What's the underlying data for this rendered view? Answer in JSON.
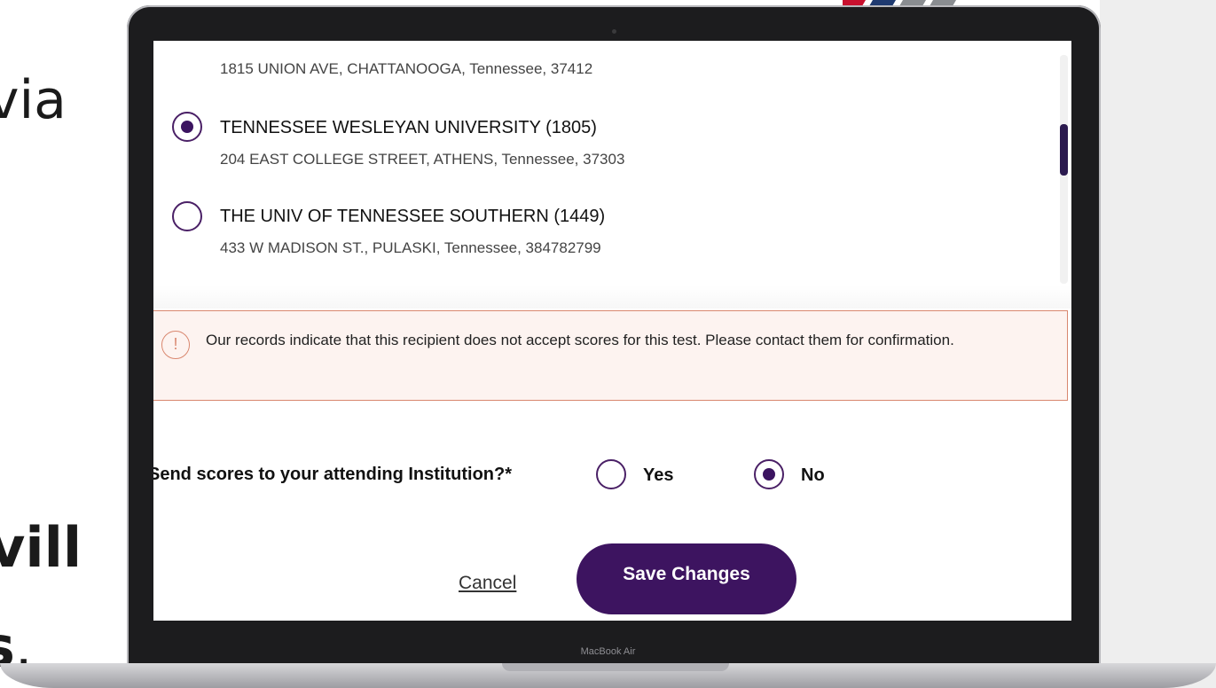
{
  "slide": {
    "fragment_top": "via",
    "fragment_mid": "vill",
    "fragment_bottom": "s",
    "fragment_bottom_punct": "."
  },
  "device": {
    "label": "MacBook Air"
  },
  "institutions": [
    {
      "name": "",
      "address": "1815 UNION AVE, CHATTANOOGA, Tennessee, 37412",
      "selected": false
    },
    {
      "name": "TENNESSEE WESLEYAN UNIVERSITY (1805)",
      "address": "204 EAST COLLEGE STREET, ATHENS, Tennessee, 37303",
      "selected": true
    },
    {
      "name": "THE UNIV OF TENNESSEE SOUTHERN (1449)",
      "address": "433 W MADISON ST., PULASKI, Tennessee, 384782799",
      "selected": false
    }
  ],
  "alert": {
    "icon": "exclamation-circle-icon",
    "text": "Our records indicate that this recipient does not accept scores for this test. Please contact them for confirmation."
  },
  "attending": {
    "question": "Send scores to your attending Institution?*",
    "options": [
      {
        "label": "Yes",
        "selected": false
      },
      {
        "label": "No",
        "selected": true
      }
    ]
  },
  "actions": {
    "cancel_label": "Cancel",
    "save_label": "Save Changes"
  },
  "colors": {
    "primary": "#3d1460",
    "alert_border": "#d9876f",
    "alert_bg": "#fdf3f0"
  }
}
